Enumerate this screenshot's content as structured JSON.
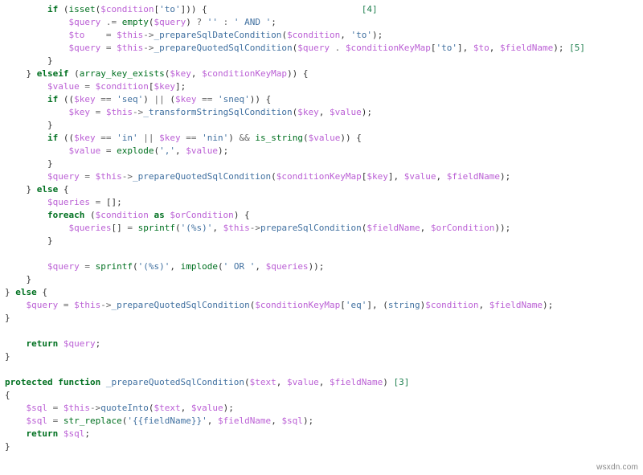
{
  "chart_data": {
    "type": "table",
    "title": "PHP source fragment — _prepareQuotedSqlCondition and caller",
    "code_lines": [
      "        if (isset($condition['to'])) {                             [4]",
      "            $query .= empty($query) ? '' : ' AND ';",
      "            $to    = $this->_prepareSqlDateCondition($condition, 'to');",
      "            $query = $this->_prepareQuotedSqlCondition($query . $conditionKeyMap['to'], $to, $fieldName); [5]",
      "        }",
      "    } elseif (array_key_exists($key, $conditionKeyMap)) {",
      "        $value = $condition[$key];",
      "        if (($key == 'seq') || ($key == 'sneq')) {",
      "            $key = $this->_transformStringSqlCondition($key, $value);",
      "        }",
      "        if (($key == 'in' || $key == 'nin') && is_string($value)) {",
      "            $value = explode(',', $value);",
      "        }",
      "        $query = $this->_prepareQuotedSqlCondition($conditionKeyMap[$key], $value, $fieldName);",
      "    } else {",
      "        $queries = [];",
      "        foreach ($condition as $orCondition) {",
      "            $queries[] = sprintf('(%s)', $this->prepareSqlCondition($fieldName, $orCondition));",
      "        }",
      "",
      "        $query = sprintf('(%s)', implode(' OR ', $queries));",
      "    }",
      "} else {",
      "    $query = $this->_prepareQuotedSqlCondition($conditionKeyMap['eq'], (string)$condition, $fieldName);",
      "}",
      "",
      "    return $query;",
      "}",
      "",
      "protected function _prepareQuotedSqlCondition($text, $value, $fieldName) [3]",
      "{",
      "    $sql = $this->quoteInto($text, $value);",
      "    $sql = str_replace('{{fieldName}}', $fieldName, $sql);",
      "    return $sql;",
      "}"
    ]
  },
  "watermark": "wsxdn.com",
  "t": {
    "if": "if",
    "elseif": "elseif",
    "else": "else",
    "foreach": "foreach",
    "as": "as",
    "return": "return",
    "protected": "protected",
    "function": "function",
    "isset": "isset",
    "empty": "empty",
    "array_key_exists": "array_key_exists",
    "is_string": "is_string",
    "explode": "explode",
    "sprintf": "sprintf",
    "implode": "implode",
    "str_replace": "str_replace",
    "v_condition": "$condition",
    "v_query": "$query",
    "v_to": "$to",
    "v_this": "$this",
    "v_conditionKeyMap": "$conditionKeyMap",
    "v_fieldName": "$fieldName",
    "v_key": "$key",
    "v_value": "$value",
    "v_queries": "$queries",
    "v_orCondition": "$orCondition",
    "v_text": "$text",
    "v_sql": "$sql",
    "m_prepDate": "_prepareSqlDateCondition",
    "m_prepQuoted": "_prepareQuotedSqlCondition",
    "m_transform": "_transformStringSqlCondition",
    "m_prepSql": "prepareSqlCondition",
    "m_quoteInto": "quoteInto",
    "s_to": "'to'",
    "s_empty2": "''",
    "s_and": "' AND '",
    "s_seq": "'seq'",
    "s_sneq": "'sneq'",
    "s_in": "'in'",
    "s_nin": "'nin'",
    "s_comma": "','",
    "s_parens": "'(%s)'",
    "s_or": "' OR '",
    "s_eq": "'eq'",
    "s_fieldTpl": "'{{fieldName}}'",
    "cast_string": "string",
    "a3": "[3]",
    "a4": "[4]",
    "a5": "[5]"
  }
}
